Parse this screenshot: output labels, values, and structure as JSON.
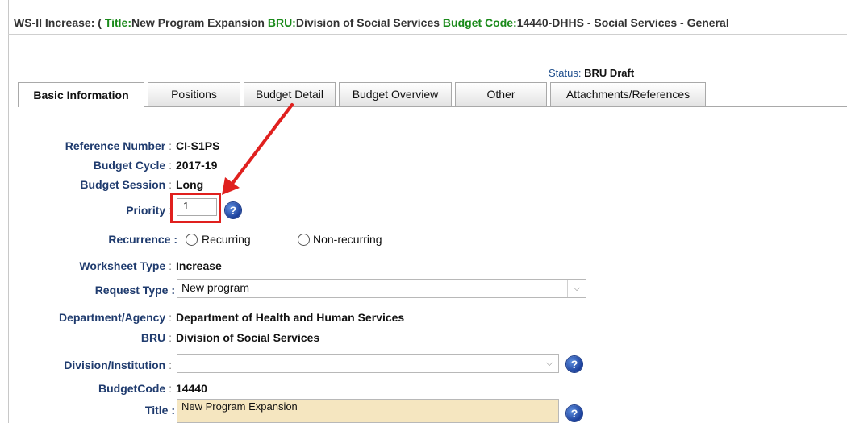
{
  "title_bar": {
    "prefix": "WS-II Increase: ( ",
    "title_key": "Title:",
    "title_value": "New Program Expansion ",
    "bru_key": "BRU:",
    "bru_value": "Division of Social Services ",
    "budget_code_key": "Budget Code:",
    "budget_code_value": "14440-DHHS - Social Services - General"
  },
  "status": {
    "label": "Status: ",
    "value": "BRU Draft"
  },
  "tabs": [
    {
      "label": "Basic Information",
      "active": true
    },
    {
      "label": "Positions"
    },
    {
      "label": "Budget Detail"
    },
    {
      "label": "Budget Overview"
    },
    {
      "label": "Other"
    },
    {
      "label": "Attachments/References"
    }
  ],
  "form": {
    "reference_number": {
      "label": "Reference Number",
      "value": "CI-S1PS"
    },
    "budget_cycle": {
      "label": "Budget Cycle",
      "value": "2017-19"
    },
    "budget_session": {
      "label": "Budget Session",
      "value": "Long"
    },
    "priority": {
      "label": "Priority",
      "value": "1"
    },
    "recurrence": {
      "label": "Recurrence :",
      "option1": "Recurring",
      "option2": "Non-recurring"
    },
    "worksheet_type": {
      "label": "Worksheet Type",
      "value": "Increase"
    },
    "request_type": {
      "label": "Request Type :",
      "value": "New program"
    },
    "department": {
      "label": "Department/Agency",
      "value": "Department of Health and Human Services"
    },
    "bru": {
      "label": "BRU",
      "value": "Division of Social Services"
    },
    "division": {
      "label": "Division/Institution",
      "value": ""
    },
    "budget_code": {
      "label": "BudgetCode",
      "value": "14440"
    },
    "title": {
      "label": "Title :",
      "value": "New Program Expansion"
    }
  },
  "icons": {
    "help": "help-icon",
    "dropdown": "chevron-down-icon",
    "annotation_color": "#e0201e"
  }
}
